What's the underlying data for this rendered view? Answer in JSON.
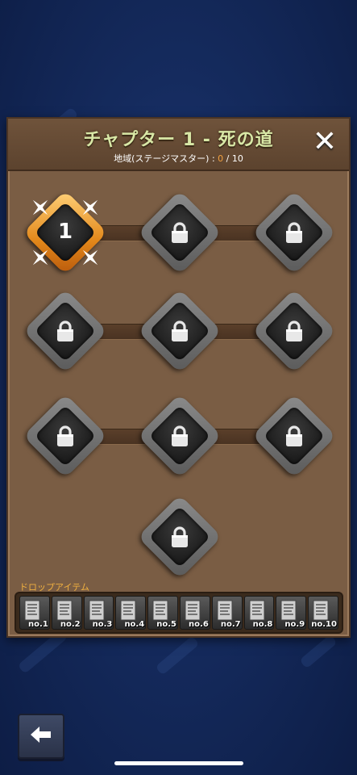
{
  "header": {
    "title": "チャプター 1 - 死の道",
    "subtitle_prefix": "地域(ステージマスター) : ",
    "progress_current": "0",
    "progress_sep": " / ",
    "progress_total": "10",
    "close_glyph": "✕"
  },
  "stages": [
    {
      "label": "1",
      "state": "unlocked",
      "icon": "number"
    },
    {
      "label": "",
      "state": "locked",
      "icon": "lock-icon"
    },
    {
      "label": "",
      "state": "locked",
      "icon": "lock-icon"
    },
    {
      "label": "",
      "state": "locked",
      "icon": "lock-icon"
    },
    {
      "label": "",
      "state": "locked",
      "icon": "lock-icon"
    },
    {
      "label": "",
      "state": "locked",
      "icon": "lock-icon"
    },
    {
      "label": "",
      "state": "locked",
      "icon": "lock-icon"
    },
    {
      "label": "",
      "state": "locked",
      "icon": "lock-icon"
    },
    {
      "label": "",
      "state": "locked",
      "icon": "lock-icon"
    },
    {
      "label": "",
      "state": "locked",
      "icon": "lock-icon"
    }
  ],
  "drops": {
    "label": "ドロップアイテム",
    "items": [
      "no.1",
      "no.2",
      "no.3",
      "no.4",
      "no.5",
      "no.6",
      "no.7",
      "no.8",
      "no.9",
      "no.10"
    ]
  },
  "back_button": {
    "glyph": "🡄",
    "icon": "back-arrow-icon"
  },
  "colors": {
    "panel": "#7a5d44",
    "title": "#d8e7a6",
    "progress_current": "#f0a040",
    "active_stage": "#e2871a"
  }
}
